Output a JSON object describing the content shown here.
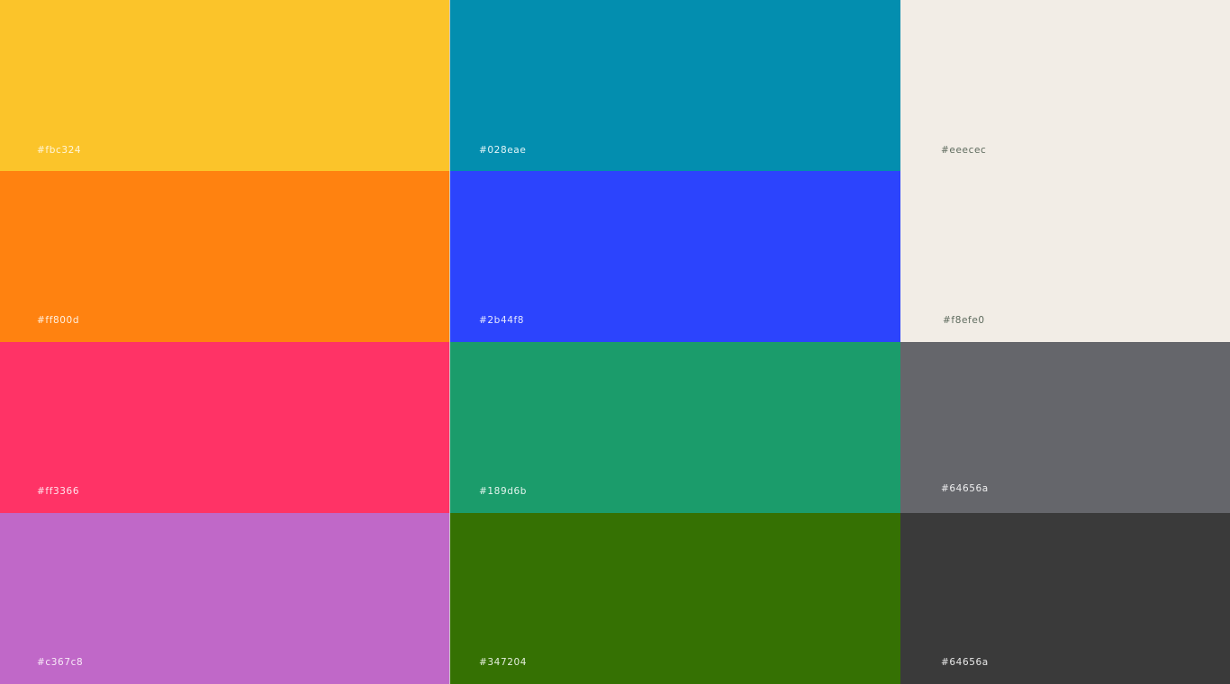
{
  "palette": {
    "columns": [
      {
        "swatches": [
          {
            "label": "#fbc324",
            "color": "#fbc42a",
            "text_color": "#fff6da"
          },
          {
            "label": "#ff800d",
            "color": "#ff8210",
            "text_color": "#fff1e2"
          },
          {
            "label": "#ff3366",
            "color": "#ff3366",
            "text_color": "#ffe5ec"
          },
          {
            "label": "#c367c8",
            "color": "#c068c8",
            "text_color": "#f8eaf8"
          }
        ]
      },
      {
        "swatches": [
          {
            "label": "#028eae",
            "color": "#038eaf",
            "text_color": "#e3f5f8"
          },
          {
            "label": "#2b44f8",
            "color": "#2c44fd",
            "text_color": "#e5e8ff"
          },
          {
            "label": "#189d6b",
            "color": "#1b9c6b",
            "text_color": "#e3f5ee"
          },
          {
            "label": "#347204",
            "color": "#357103",
            "text_color": "#e6efde"
          }
        ]
      },
      {
        "swatches": [
          {
            "label": "#eeecec",
            "color": "#f2ede6",
            "text_color": "#5e6b5e"
          },
          {
            "label": "#f8efe0",
            "color": "#f2ede6",
            "text_color": "#5e6b5e"
          },
          {
            "label": "#64656a",
            "color": "#65666b",
            "text_color": "#eeeeef"
          },
          {
            "label": "#64656a",
            "color": "#3a3a3a",
            "text_color": "#e8e8e8"
          }
        ]
      }
    ]
  }
}
